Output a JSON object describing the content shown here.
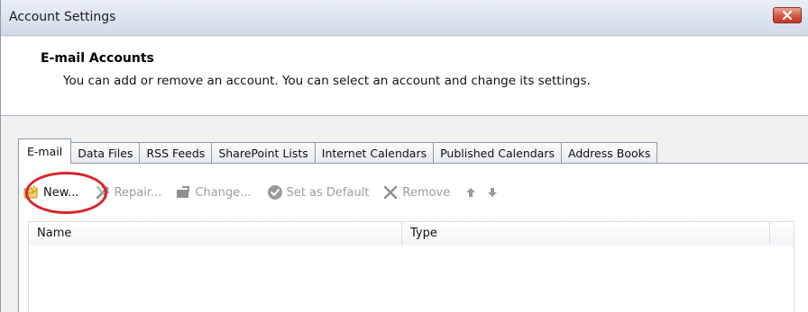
{
  "window": {
    "title": "Account Settings"
  },
  "header": {
    "title": "E-mail Accounts",
    "description": "You can add or remove an account. You can select an account and change its settings."
  },
  "tabs": [
    {
      "label": "E-mail",
      "active": true
    },
    {
      "label": "Data Files",
      "active": false
    },
    {
      "label": "RSS Feeds",
      "active": false
    },
    {
      "label": "SharePoint Lists",
      "active": false
    },
    {
      "label": "Internet Calendars",
      "active": false
    },
    {
      "label": "Published Calendars",
      "active": false
    },
    {
      "label": "Address Books",
      "active": false
    }
  ],
  "toolbar": {
    "new_label": "New...",
    "repair_label": "Repair...",
    "change_label": "Change...",
    "set_default_label": "Set as Default",
    "remove_label": "Remove",
    "icons": {
      "new": "new-account-icon",
      "repair": "repair-tools-icon",
      "change": "change-icon",
      "set_default": "checkmark-circle-icon",
      "remove": "remove-x-icon",
      "move_up": "arrow-up-icon",
      "move_down": "arrow-down-icon"
    }
  },
  "list": {
    "columns": [
      "Name",
      "Type"
    ],
    "rows": []
  },
  "colors": {
    "highlight": "#d9232b",
    "close_button": "#c0392b",
    "titlebar": "#dbe4ee"
  }
}
